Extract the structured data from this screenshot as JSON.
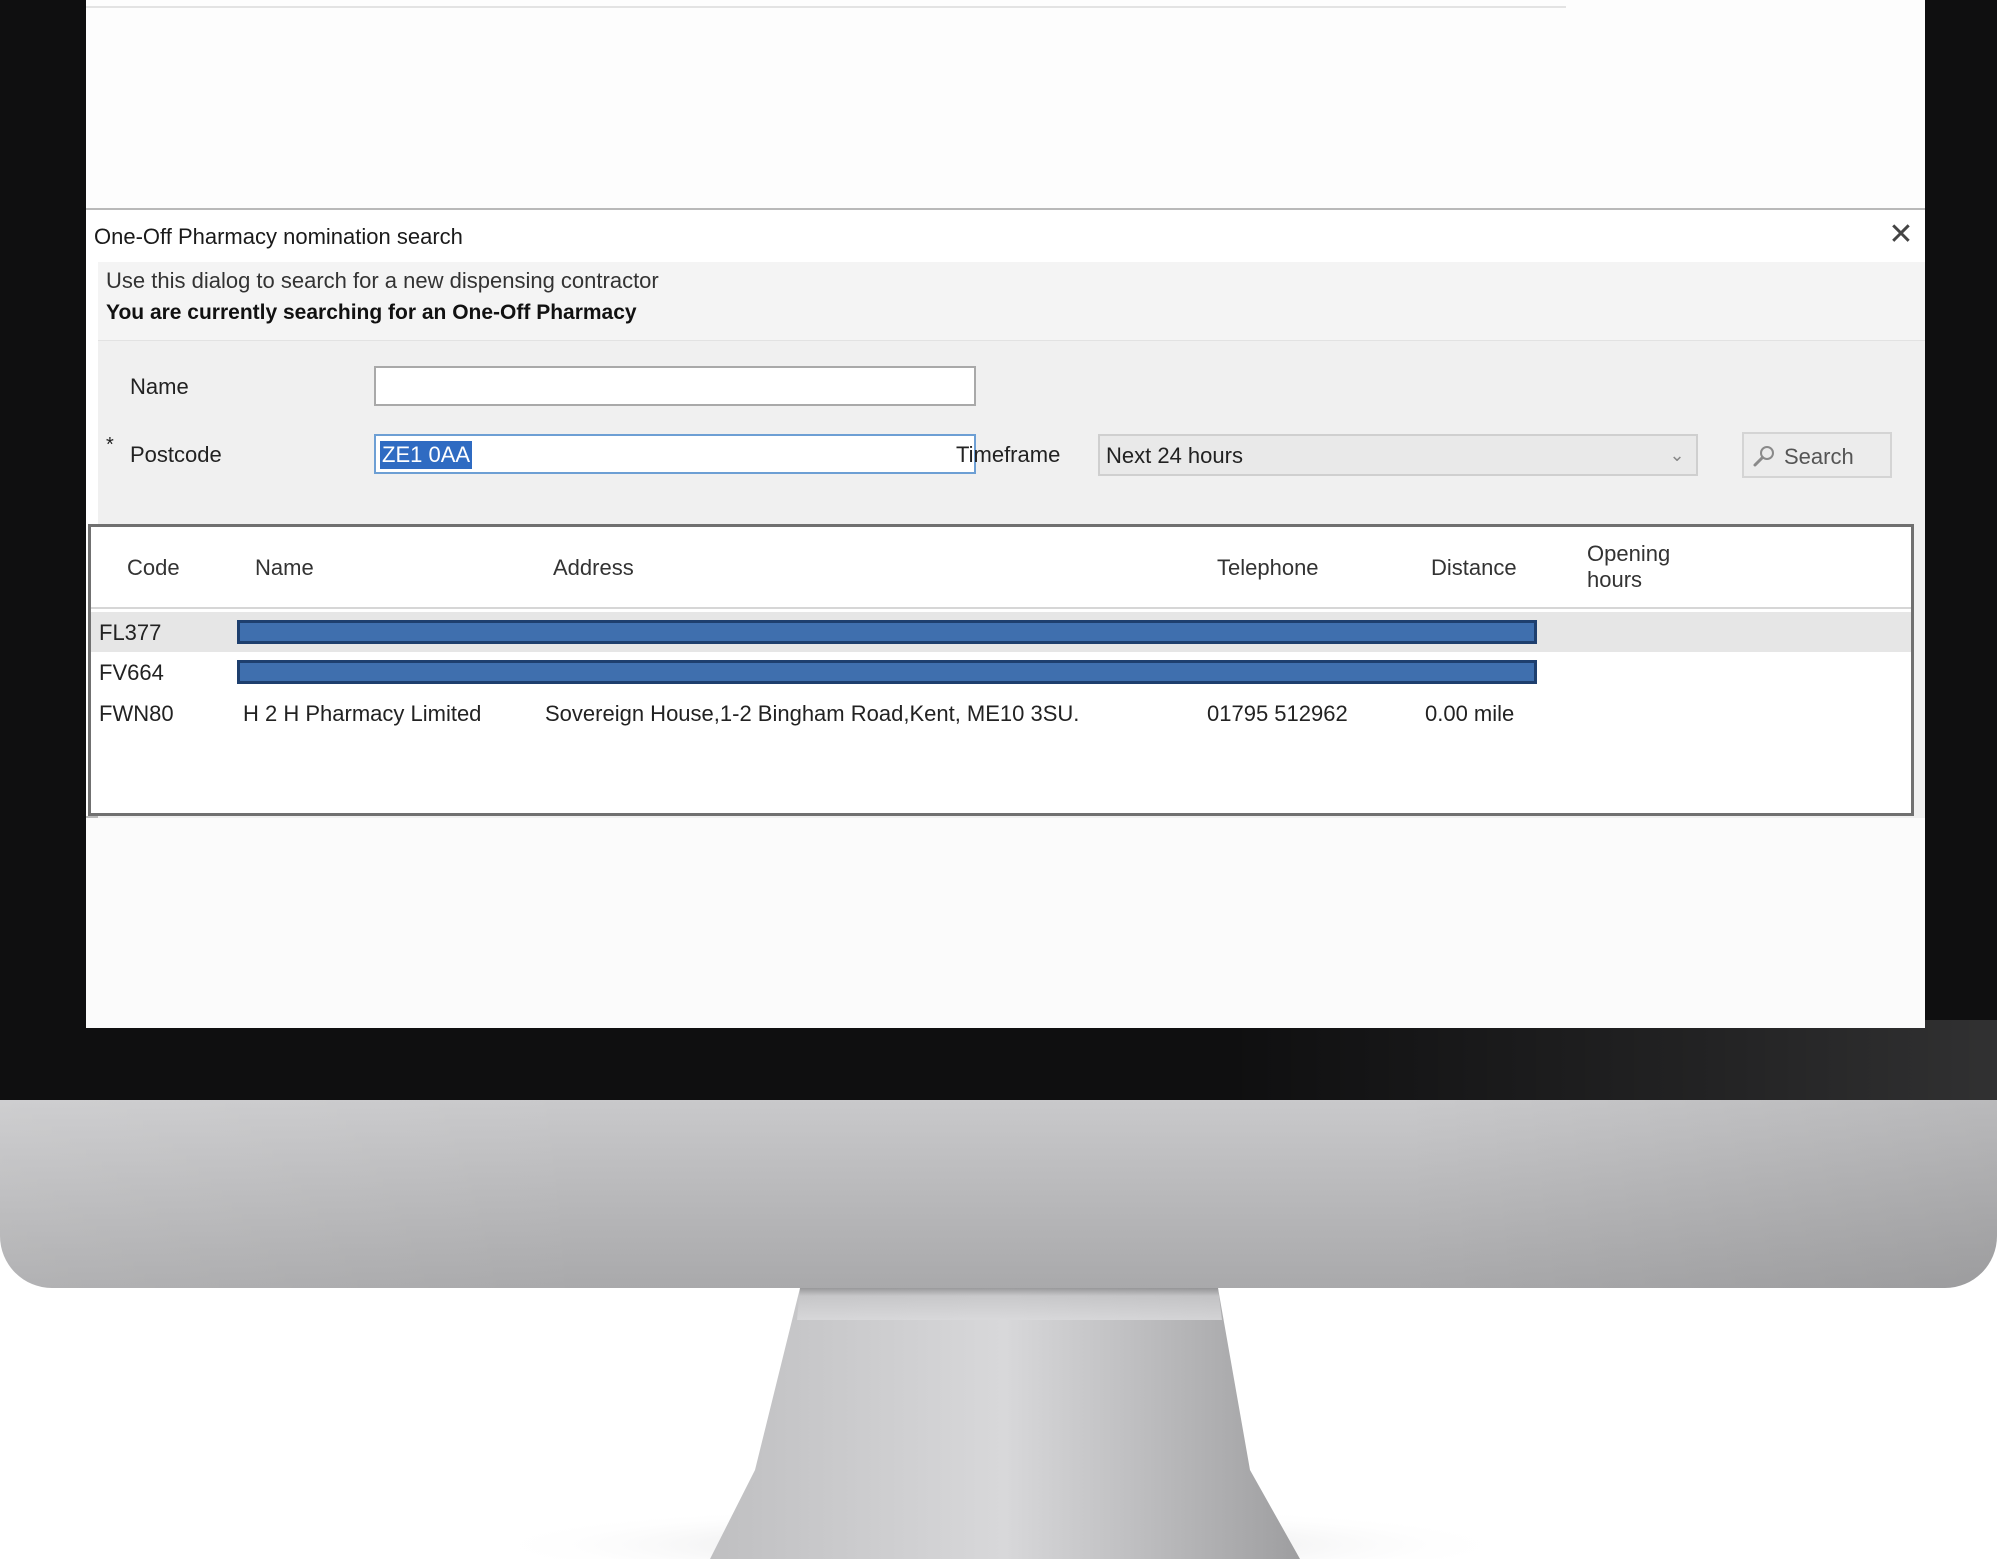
{
  "dialog": {
    "title": "One-Off Pharmacy nomination search",
    "close_glyph": "✕",
    "banner_line1": "Use this dialog to search for a new dispensing contractor",
    "banner_line2": "You are currently searching for an One-Off Pharmacy"
  },
  "form": {
    "name_label": "Name",
    "name_value": "",
    "required_mark": "*",
    "postcode_label": "Postcode",
    "postcode_value": "ZE1 0AA",
    "timeframe_label": "Timeframe",
    "timeframe_value": "Next 24 hours",
    "search_label": "Search",
    "icons": {
      "timeframe_dropdown": "chevron-down-icon",
      "search": "search-icon",
      "close": "close-icon"
    }
  },
  "results": {
    "columns": [
      "Code",
      "Name",
      "Address",
      "Telephone",
      "Distance",
      "Opening hours"
    ],
    "rows": [
      {
        "code": "FL377",
        "redacted": true,
        "selected": true
      },
      {
        "code": "FV664",
        "redacted": true,
        "selected": false
      },
      {
        "code": "FWN80",
        "name": "H 2 H Pharmacy Limited",
        "address": "Sovereign House,1-2 Bingham Road,Kent, ME10 3SU.",
        "telephone": "01795 512962",
        "distance": "0.00 mile",
        "opening_hours": "",
        "redacted": false,
        "selected": false
      }
    ]
  },
  "colors": {
    "redaction_fill": "#3f6fae",
    "redaction_border": "#1e3f6e",
    "selection_highlight": "#2f6bc2",
    "monitor_bezel": "#0f0f10",
    "monitor_silver": "#c0c0c2"
  }
}
